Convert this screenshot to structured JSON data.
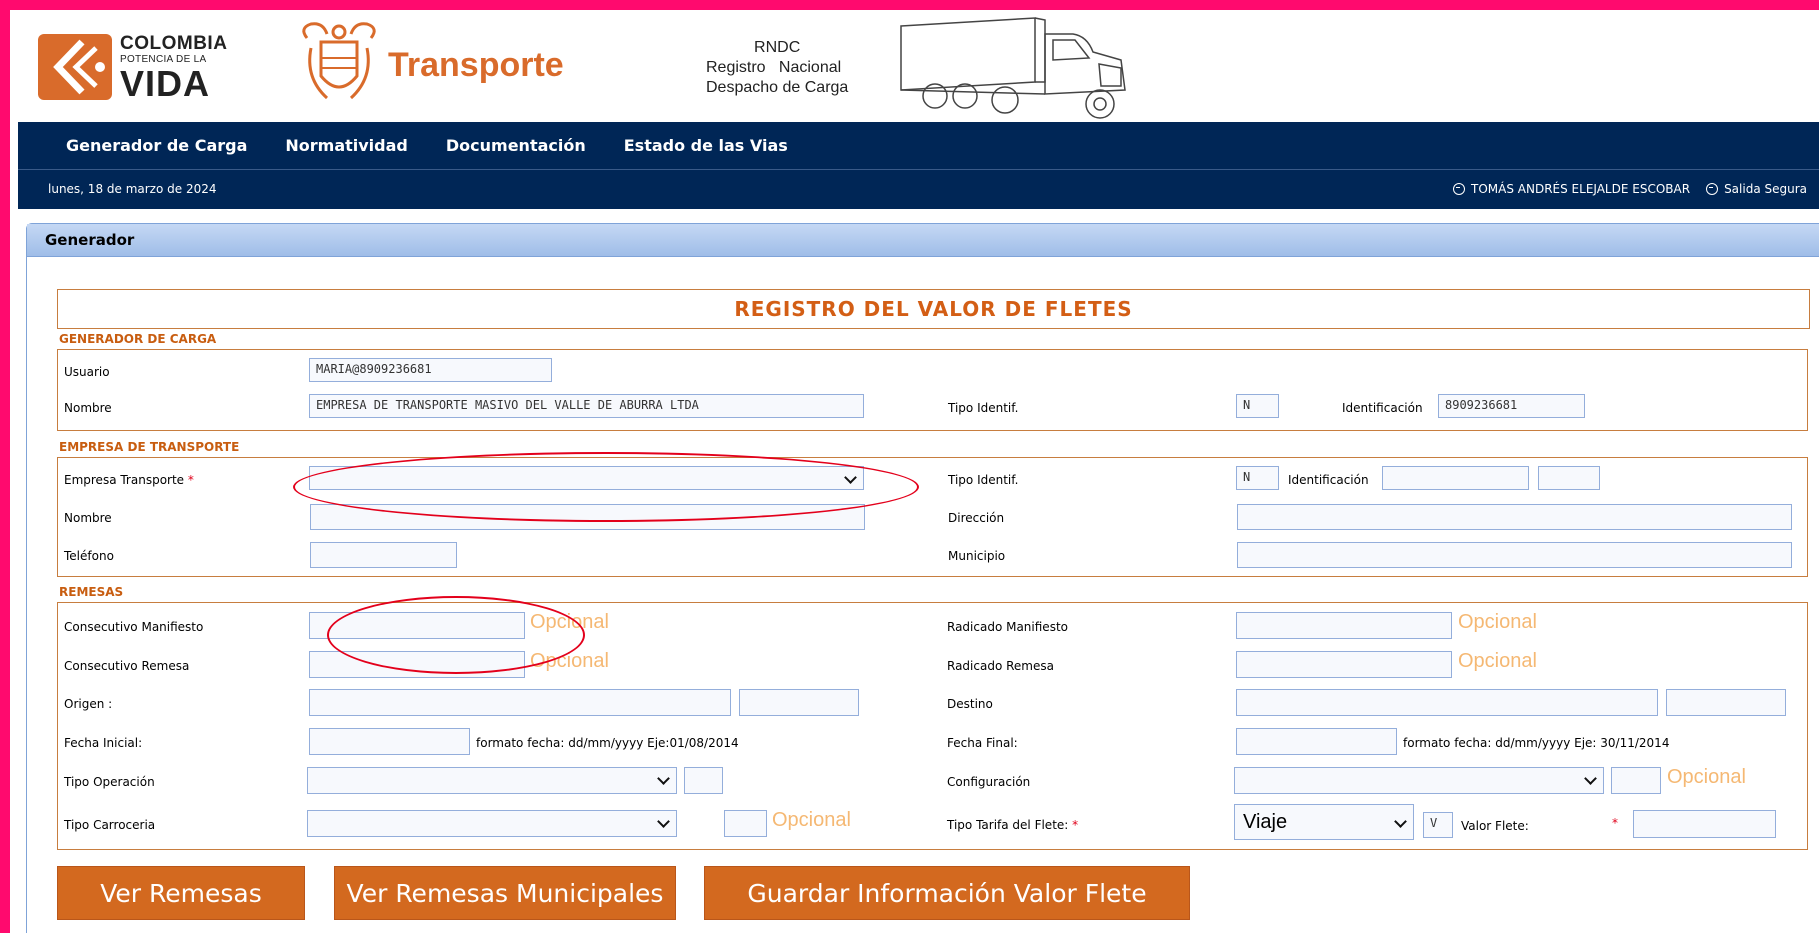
{
  "header": {
    "logo": {
      "line1": "COLOMBIA",
      "line2": "POTENCIA DE LA",
      "line3": "VIDA"
    },
    "ministry": "Transporte",
    "rndc": {
      "line1": "RNDC",
      "line2": "Registro   Nacional",
      "line3": "Despacho de Carga"
    }
  },
  "nav": {
    "items": [
      "Generador de Carga",
      "Normatividad",
      "Documentación",
      "Estado de las Vias"
    ],
    "date": "lunes, 18 de marzo de 2024",
    "user": "TOMÁS ANDRÉS ELEJALDE ESCOBAR",
    "logout": "Salida Segura"
  },
  "panel": {
    "title": "Generador",
    "banner": "REGISTRO DEL VALOR DE FLETES"
  },
  "generador": {
    "section": "GENERADOR DE CARGA",
    "usuario_label": "Usuario",
    "usuario_value": "MARIA@8909236681",
    "nombre_label": "Nombre",
    "nombre_value": "EMPRESA DE TRANSPORTE MASIVO DEL VALLE DE ABURRA LTDA",
    "tipo_label": "Tipo Identif.",
    "tipo_value": "N",
    "id_label": "Identificación",
    "id_value": "8909236681"
  },
  "empresa": {
    "section": "EMPRESA DE TRANSPORTE",
    "empresa_label": "Empresa Transporte",
    "required": "*",
    "tipo_label": "Tipo Identif.",
    "tipo_value": "N",
    "id_label": "Identificación",
    "nombre_label": "Nombre",
    "direccion_label": "Dirección",
    "telefono_label": "Teléfono",
    "municipio_label": "Municipio"
  },
  "remesas": {
    "section": "REMESAS",
    "opcional": "Opcional",
    "cons_manifiesto_label": "Consecutivo Manifiesto",
    "rad_manifiesto_label": "Radicado Manifiesto",
    "cons_remesa_label": "Consecutivo Remesa",
    "rad_remesa_label": "Radicado Remesa",
    "origen_label": "Origen :",
    "destino_label": "Destino",
    "fecha_inicial_label": "Fecha Inicial:",
    "fecha_inicial_hint": "formato fecha: dd/mm/yyyy Eje:01/08/2014",
    "fecha_final_label": "Fecha Final:",
    "fecha_final_hint": "formato fecha: dd/mm/yyyy Eje: 30/11/2014",
    "tipo_operacion_label": "Tipo Operación",
    "configuracion_label": "Configuración",
    "tipo_carroceria_label": "Tipo Carroceria",
    "tipo_tarifa_label": "Tipo Tarifa del Flete:",
    "tipo_tarifa_value": "Viaje",
    "tarifa_code": "V",
    "valor_flete_label": "Valor Flete:",
    "required": "*"
  },
  "buttons": {
    "ver_remesas": "Ver Remesas",
    "ver_municipales": "Ver Remesas Municipales",
    "guardar": "Guardar Información Valor Flete"
  },
  "colors": {
    "brand_orange": "#d3691f",
    "nav_blue": "#002656",
    "frame": "#ff0a6e",
    "annotation_red": "#e3001b"
  }
}
